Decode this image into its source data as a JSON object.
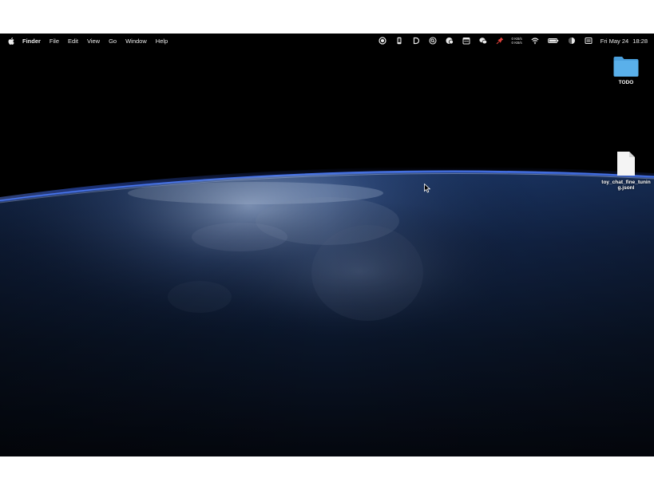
{
  "menubar": {
    "app_name": "Finder",
    "menus": [
      "File",
      "Edit",
      "View",
      "Go",
      "Window",
      "Help"
    ],
    "status_icons": [
      "record-icon",
      "phone-icon",
      "dash-d-icon",
      "search-badge-icon",
      "cloud-copy-icon",
      "calendar-icon",
      "wechat-icon",
      "pin-icon"
    ],
    "net_up": "0 KB/s",
    "net_down": "0 KB/s",
    "day_date": "Fri May 24",
    "time": "18:28"
  },
  "desktop": {
    "icons": [
      {
        "name": "TODO",
        "type": "folder"
      },
      {
        "name": "toy_chat_fine_tuning.jsonl",
        "type": "file"
      }
    ]
  },
  "colors": {
    "folder": "#5ab0ea",
    "atmosphere": "#3d6cff",
    "earth_dark": "#0b1a33"
  }
}
